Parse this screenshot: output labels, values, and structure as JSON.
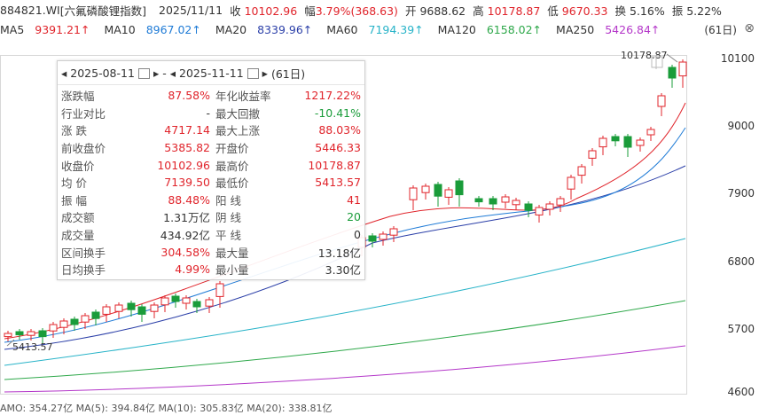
{
  "header": {
    "code": "884821.WI",
    "name": "[六氟磷酸锂指数]",
    "date": "2025/11/11",
    "close_label": "收",
    "close": "10102.96",
    "change_label": "幅",
    "change": "3.79%(368.63)",
    "open_label": "开",
    "open": "9688.62",
    "high_label": "高",
    "high": "10178.87",
    "low_label": "低",
    "low": "9670.33",
    "turnover_label": "换",
    "turnover": "5.16%",
    "amplitude_label": "振",
    "amplitude": "5.22%"
  },
  "ma": [
    {
      "label": "MA5",
      "value": "9391.21↑",
      "color": "#e0242b"
    },
    {
      "label": "MA10",
      "value": "8967.02↑",
      "color": "#1f7bd6"
    },
    {
      "label": "MA20",
      "value": "8339.96↑",
      "color": "#2b3fa8"
    },
    {
      "label": "MA60",
      "value": "7194.39↑",
      "color": "#27b3c8"
    },
    {
      "label": "MA120",
      "value": "6158.02↑",
      "color": "#2ea84a"
    },
    {
      "label": "MA250",
      "value": "5426.84↑",
      "color": "#b437c9"
    }
  ],
  "period": "(61日)",
  "panel": {
    "date_from": "2025-08-11",
    "date_to": "2025-11-11",
    "count": "(61日)",
    "rows": [
      {
        "l1": "涨跌幅",
        "v1": "87.58%",
        "c1": "red",
        "l2": "年化收益率",
        "v2": "1217.22%",
        "c2": "red"
      },
      {
        "l1": "行业对比",
        "v1": "-",
        "c1": "",
        "l2": "最大回撤",
        "v2": "-10.41%",
        "c2": "grn"
      },
      {
        "l1": "涨 跌",
        "v1": "4717.14",
        "c1": "red",
        "l2": "最大上涨",
        "v2": "88.03%",
        "c2": "red"
      },
      {
        "l1": "前收盘价",
        "v1": "5385.82",
        "c1": "red",
        "l2": "开盘价",
        "v2": "5446.33",
        "c2": "red"
      },
      {
        "l1": "收盘价",
        "v1": "10102.96",
        "c1": "red",
        "l2": "最高价",
        "v2": "10178.87",
        "c2": "red"
      },
      {
        "l1": "均 价",
        "v1": "7139.50",
        "c1": "red",
        "l2": "最低价",
        "v2": "5413.57",
        "c2": "red"
      },
      {
        "l1": "振 幅",
        "v1": "88.48%",
        "c1": "red",
        "l2": "阳 线",
        "v2": "41",
        "c2": "red"
      },
      {
        "l1": "成交额",
        "v1": "1.31万亿",
        "c1": "",
        "l2": "阴 线",
        "v2": "20",
        "c2": "grn"
      },
      {
        "l1": "成交量",
        "v1": "434.92亿",
        "c1": "",
        "l2": "平 线",
        "v2": "0",
        "c2": ""
      },
      {
        "l1": "区间换手",
        "v1": "304.58%",
        "c1": "red",
        "l2": "最大量",
        "v2": "13.18亿",
        "c2": ""
      },
      {
        "l1": "日均换手",
        "v1": "4.99%",
        "c1": "red",
        "l2": "最小量",
        "v2": "3.30亿",
        "c2": ""
      }
    ]
  },
  "yaxis": [
    "10100",
    "9000",
    "7900",
    "6800",
    "5700",
    "4600"
  ],
  "annotations": {
    "high_label": "10178.87",
    "low_label": "5413.57"
  },
  "bottom": "AMO: 354.27亿  MA(5): 394.84亿  MA(10): 305.83亿  MA(20): 338.81亿"
}
